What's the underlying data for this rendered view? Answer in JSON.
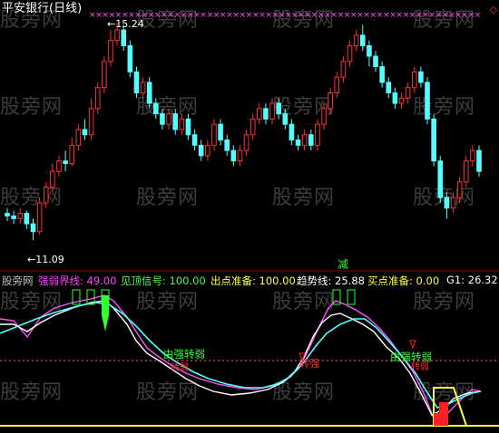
{
  "title": "平安银行(日线)",
  "watermark": "股旁网",
  "price_chart": {
    "high_label": "15.24",
    "low_label": "11.09",
    "corner_marker": "◇"
  },
  "indicator_bar": {
    "name": "股旁网",
    "items": [
      {
        "label": "强弱界线: 49.00",
        "color": "#ff40ff"
      },
      {
        "label": "见顶信号: 100.00",
        "color": "#40ff40"
      },
      {
        "label": "出点准备: 100.00",
        "color": "#ffff40"
      },
      {
        "label": "趋势线: 25.88",
        "color": "#ffffff"
      },
      {
        "label": "买点准备: 0.00",
        "color": "#ffff40"
      },
      {
        "label": "G1: 26.32",
        "color": "#ffffff"
      }
    ]
  },
  "signals": {
    "reduce": "减",
    "strong_weak": "由强转弱",
    "weak_strong": "由弱转强"
  },
  "colors": {
    "up": "#ff3030",
    "down": "#54ffff",
    "magenta": "#ff50ff",
    "cyan": "#54ffff",
    "white": "#ffffff",
    "yellow": "#ffff40",
    "green": "#30ff30",
    "red": "#ff2020"
  },
  "chart_data": {
    "type": "candlestick",
    "price_range": [
      11.09,
      15.24
    ],
    "candles": [
      [
        11.6,
        11.55,
        11.7,
        11.45
      ],
      [
        11.55,
        11.5,
        11.65,
        11.4
      ],
      [
        11.5,
        11.6,
        11.7,
        11.4
      ],
      [
        11.6,
        11.4,
        11.65,
        11.3
      ],
      [
        11.4,
        11.25,
        11.5,
        11.09
      ],
      [
        11.25,
        11.8,
        11.9,
        11.2
      ],
      [
        11.8,
        12.1,
        12.2,
        11.7
      ],
      [
        12.1,
        12.4,
        12.55,
        12.0
      ],
      [
        12.4,
        12.6,
        12.7,
        12.3
      ],
      [
        12.6,
        12.55,
        12.8,
        12.4
      ],
      [
        12.55,
        12.9,
        13.05,
        12.5
      ],
      [
        12.9,
        13.2,
        13.3,
        12.8
      ],
      [
        13.2,
        13.1,
        13.4,
        13.0
      ],
      [
        13.1,
        13.6,
        13.8,
        13.0
      ],
      [
        13.6,
        14.0,
        14.1,
        13.5
      ],
      [
        14.0,
        14.5,
        14.6,
        13.9
      ],
      [
        14.5,
        14.9,
        15.1,
        14.4
      ],
      [
        14.9,
        15.1,
        15.24,
        14.8
      ],
      [
        15.1,
        14.8,
        15.2,
        14.7
      ],
      [
        14.8,
        14.3,
        14.9,
        14.2
      ],
      [
        14.3,
        13.9,
        14.4,
        13.8
      ],
      [
        13.9,
        14.1,
        14.2,
        13.8
      ],
      [
        14.1,
        13.7,
        14.2,
        13.6
      ],
      [
        13.7,
        13.5,
        13.8,
        13.4
      ],
      [
        13.5,
        13.3,
        13.6,
        13.2
      ],
      [
        13.3,
        13.5,
        13.6,
        13.2
      ],
      [
        13.5,
        13.2,
        13.6,
        13.1
      ],
      [
        13.2,
        13.4,
        13.5,
        13.1
      ],
      [
        13.4,
        13.1,
        13.5,
        13.0
      ],
      [
        13.1,
        12.9,
        13.2,
        12.8
      ],
      [
        12.9,
        12.7,
        13.0,
        12.6
      ],
      [
        12.7,
        12.9,
        13.0,
        12.6
      ],
      [
        12.9,
        13.3,
        13.4,
        12.8
      ],
      [
        13.3,
        13.0,
        13.4,
        12.9
      ],
      [
        13.0,
        12.8,
        13.1,
        12.7
      ],
      [
        12.8,
        12.6,
        12.9,
        12.5
      ],
      [
        12.6,
        12.8,
        12.9,
        12.5
      ],
      [
        12.8,
        13.1,
        13.2,
        12.7
      ],
      [
        13.1,
        13.4,
        13.5,
        13.0
      ],
      [
        13.4,
        13.6,
        13.7,
        13.3
      ],
      [
        13.6,
        13.4,
        13.7,
        13.3
      ],
      [
        13.4,
        13.7,
        13.8,
        13.3
      ],
      [
        13.7,
        13.5,
        13.8,
        13.4
      ],
      [
        13.5,
        13.3,
        13.6,
        13.2
      ],
      [
        13.3,
        13.0,
        13.4,
        12.9
      ],
      [
        13.0,
        12.9,
        13.1,
        12.8
      ],
      [
        12.9,
        13.1,
        13.2,
        12.8
      ],
      [
        13.1,
        12.9,
        13.2,
        12.8
      ],
      [
        12.9,
        13.3,
        13.4,
        12.8
      ],
      [
        13.3,
        13.6,
        13.7,
        13.2
      ],
      [
        13.6,
        13.9,
        14.0,
        13.5
      ],
      [
        13.9,
        14.2,
        14.3,
        13.8
      ],
      [
        14.2,
        14.5,
        14.6,
        14.1
      ],
      [
        14.5,
        14.8,
        14.9,
        14.4
      ],
      [
        14.8,
        15.0,
        15.1,
        14.7
      ],
      [
        15.0,
        14.8,
        15.2,
        14.7
      ],
      [
        14.8,
        14.6,
        14.9,
        14.4
      ],
      [
        14.6,
        14.4,
        14.7,
        14.3
      ],
      [
        14.4,
        14.1,
        14.5,
        14.0
      ],
      [
        14.1,
        13.9,
        14.2,
        13.8
      ],
      [
        13.9,
        13.7,
        14.0,
        13.6
      ],
      [
        13.7,
        13.8,
        13.9,
        13.6
      ],
      [
        13.8,
        14.0,
        14.1,
        13.7
      ],
      [
        14.0,
        14.3,
        14.4,
        13.9
      ],
      [
        14.3,
        14.1,
        14.4,
        14.0
      ],
      [
        14.1,
        13.4,
        14.2,
        13.3
      ],
      [
        13.4,
        12.6,
        13.5,
        12.5
      ],
      [
        12.6,
        11.9,
        12.7,
        11.8
      ],
      [
        11.9,
        11.7,
        12.0,
        11.5
      ],
      [
        11.7,
        11.9,
        12.0,
        11.6
      ],
      [
        11.9,
        12.2,
        12.3,
        11.8
      ],
      [
        12.2,
        12.6,
        12.7,
        12.1
      ],
      [
        12.6,
        12.8,
        12.9,
        12.5
      ],
      [
        12.8,
        12.4,
        12.9,
        12.3
      ]
    ]
  }
}
